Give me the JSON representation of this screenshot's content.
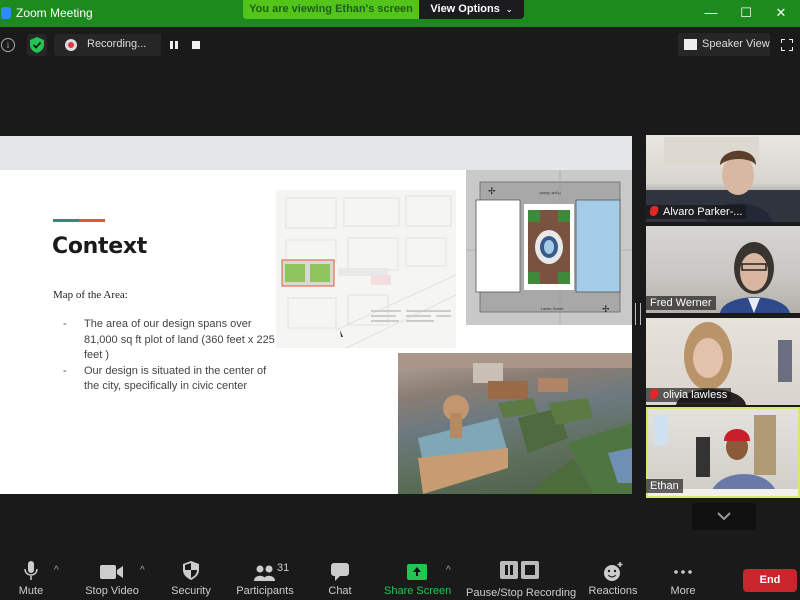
{
  "window": {
    "app_title": "Zoom Meeting",
    "viewing_banner": "You are viewing Ethan's screen",
    "view_options_label": "View Options",
    "minimize": "—",
    "maximize": "☐",
    "close": "✕"
  },
  "topbar": {
    "info_icon": "i",
    "recording_label": "Recording...",
    "speaker_view_label": "Speaker View"
  },
  "slide": {
    "title": "Context",
    "subtitle": "Map of the Area:",
    "accent_colors": [
      "#2e8a7a",
      "#e05a2f"
    ],
    "bullets": [
      "The area of our design spans over 81,000 sq ft plot of land (360 feet x 225 feet )",
      "Our design is situated in the center of the city, specifically in civic center"
    ],
    "bullet_marker": "-",
    "plan_street_top": "Hyde Street",
    "plan_street_bottom": "Larkin Street"
  },
  "participants": [
    {
      "name": "Alvaro Parker-...",
      "muted": true
    },
    {
      "name": "Fred Werner",
      "muted": false
    },
    {
      "name": "olivia lawless",
      "muted": true
    },
    {
      "name": "Ethan",
      "muted": false,
      "active_speaker": true
    }
  ],
  "toolbar": {
    "mute": "Mute",
    "stop_video": "Stop Video",
    "security": "Security",
    "participants": "Participants",
    "participants_count": "31",
    "chat": "Chat",
    "share_screen": "Share Screen",
    "pause_stop_recording": "Pause/Stop Recording",
    "reactions": "Reactions",
    "more": "More",
    "end": "End"
  },
  "colors": {
    "titlebar_green": "#1d8a1d",
    "banner_green": "#52c41a",
    "share_green": "#23c552",
    "end_red": "#c8262c",
    "active_speaker_border": "#d7e86a"
  }
}
